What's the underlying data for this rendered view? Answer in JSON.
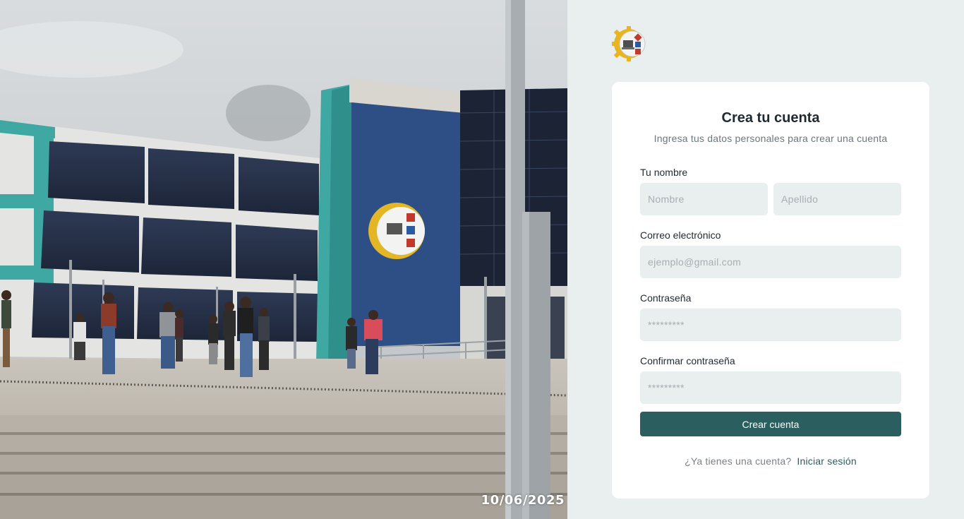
{
  "photo": {
    "date_stamp": "10/06/2025"
  },
  "logo": {
    "icon": "faculty-gear-logo-icon"
  },
  "card": {
    "title": "Crea tu cuenta",
    "subtitle": "Ingresa tus datos personales para crear una cuenta",
    "name_label": "Tu nombre",
    "first_name_placeholder": "Nombre",
    "last_name_placeholder": "Apellido",
    "email_label": "Correo electrónico",
    "email_placeholder": "ejemplo@gmail.com",
    "password_label": "Contraseña",
    "password_placeholder": "*********",
    "confirm_label": "Confirmar contraseña",
    "confirm_placeholder": "*********",
    "submit_label": "Crear cuenta",
    "footer_text": "¿Ya tienes una cuenta?",
    "login_link": "Iniciar sesión"
  },
  "colors": {
    "accent": "#2a5e5f",
    "panel_bg": "#e9eeef",
    "card_bg": "#ffffff",
    "input_bg": "#e9eeef"
  }
}
